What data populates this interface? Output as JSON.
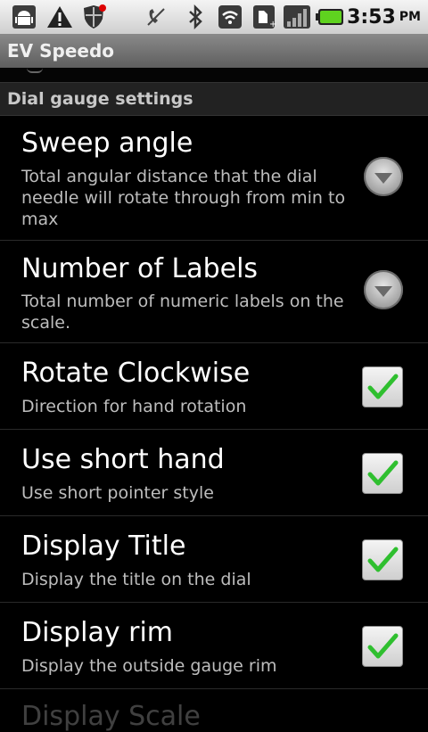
{
  "status_bar": {
    "icons": [
      "android-debug-icon",
      "warning-icon",
      "shield-icon",
      "no-signal-phone-icon",
      "bluetooth-icon",
      "wifi-icon",
      "sd-card-icon",
      "signal-bars-icon",
      "battery-icon"
    ],
    "time": "3:53",
    "ampm": "PM"
  },
  "app": {
    "title": "EV Speedo"
  },
  "category": {
    "label": "Dial gauge settings"
  },
  "preferences": [
    {
      "title": "Sweep angle",
      "summary": "Total angular distance that the dial needle will rotate through from min to max",
      "widget": "dropdown"
    },
    {
      "title": "Number of Labels",
      "summary": "Total number of numeric labels on the scale.",
      "widget": "dropdown"
    },
    {
      "title": "Rotate Clockwise",
      "summary": "Direction for hand rotation",
      "widget": "checkbox",
      "checked": true
    },
    {
      "title": "Use short hand",
      "summary": "Use short pointer style",
      "widget": "checkbox",
      "checked": true
    },
    {
      "title": "Display Title",
      "summary": "Display the title on the dial",
      "widget": "checkbox",
      "checked": true
    },
    {
      "title": "Display rim",
      "summary": "Display the outside gauge rim",
      "widget": "checkbox",
      "checked": true
    }
  ],
  "partial_next": "Display Scale",
  "colors": {
    "check": "#33cc33",
    "background": "#000000"
  }
}
